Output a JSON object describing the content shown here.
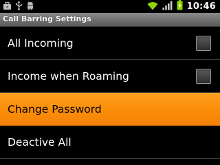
{
  "status_bar": {
    "icons_left": [
      "briefcase-icon",
      "usb-icon",
      "android-debug-icon"
    ],
    "icons_right": [
      "wifi-icon",
      "signal-icon",
      "battery-charging-icon"
    ],
    "time": "10:46"
  },
  "title": "Call Barring Settings",
  "colors": {
    "highlight": "#fb8f09",
    "title_bar": "#6e6e6e",
    "background": "#000000"
  },
  "items": [
    {
      "label": "All Incoming",
      "has_checkbox": true,
      "checked": false
    },
    {
      "label": "Income when Roaming",
      "has_checkbox": true,
      "checked": false
    },
    {
      "label": "Change Password",
      "has_checkbox": false,
      "highlighted": true
    },
    {
      "label": "Deactive All",
      "has_checkbox": false
    }
  ]
}
